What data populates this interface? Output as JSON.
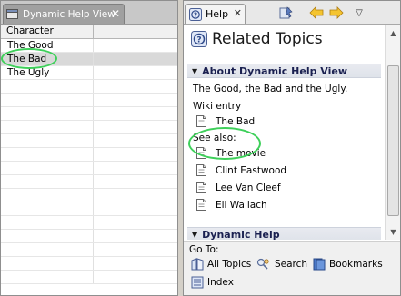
{
  "left_view": {
    "tab_title": "Dynamic Help View",
    "columns": [
      "Character",
      ""
    ],
    "rows": [
      "The Good",
      "The Bad",
      "The Ugly",
      "",
      "",
      "",
      "",
      "",
      "",
      "",
      "",
      "",
      "",
      "",
      "",
      "",
      "",
      ""
    ],
    "selected_row": 1
  },
  "right_view": {
    "tab_title": "Help",
    "heading": "Related Topics",
    "section_about": "About Dynamic Help View",
    "description": "The Good, the Bad and the Ugly.",
    "wiki_label": "Wiki entry",
    "wiki_items": [
      "The Bad"
    ],
    "see_also_label": "See also:",
    "see_also_items": [
      "The movie",
      "Clint Eastwood",
      "Lee Van Cleef",
      "Eli Wallach"
    ],
    "section_dynamic": "Dynamic Help",
    "goto": {
      "label": "Go To:",
      "all_topics": "All Topics",
      "search": "Search",
      "bookmarks": "Bookmarks",
      "index": "Index"
    }
  },
  "colors": {
    "highlight_circle": "#3ed05a",
    "section_title": "#1a2050",
    "selected_row": "#d9d9d9"
  },
  "icons": [
    "view-icon",
    "close-icon",
    "help-icon",
    "toolbar-icon",
    "back-arrow-icon",
    "forward-arrow-icon",
    "menu-chevron-icon",
    "document-icon",
    "all-topics-icon",
    "search-icon",
    "bookmarks-icon",
    "index-icon"
  ]
}
